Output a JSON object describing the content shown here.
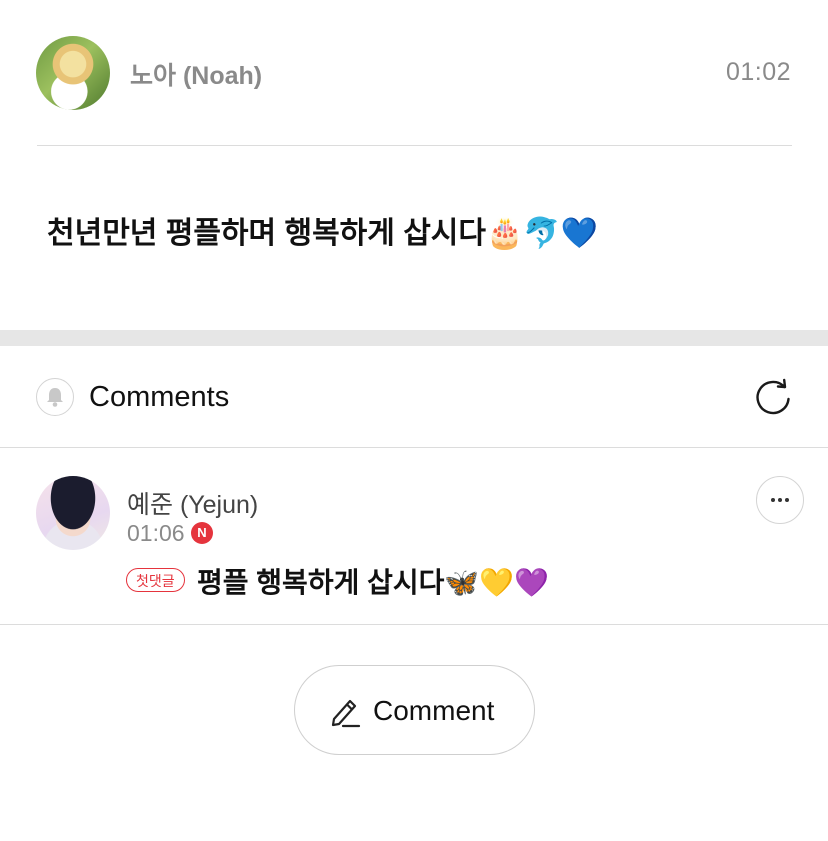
{
  "post": {
    "author": "노아 (Noah)",
    "time": "01:02",
    "text": "천년만년 평플하며 행복하게 삽시다🎂🐬💙"
  },
  "comments_section": {
    "title": "Comments",
    "bell_icon": "bell-icon",
    "refresh_icon": "refresh-icon"
  },
  "comment": {
    "author": "예준 (Yejun)",
    "time": "01:06",
    "new_badge": "N",
    "tag": "첫댓글",
    "text": "평플 행복하게 삽시다🦋💛💜",
    "more_icon": "more-horizontal-icon"
  },
  "write_button": {
    "label": "Comment",
    "icon": "pencil-icon"
  },
  "colors": {
    "accent_red": "#e5343d",
    "muted_text": "#8a8a8a",
    "divider": "#dcdcdc",
    "section_gap": "#e6e6e6"
  }
}
